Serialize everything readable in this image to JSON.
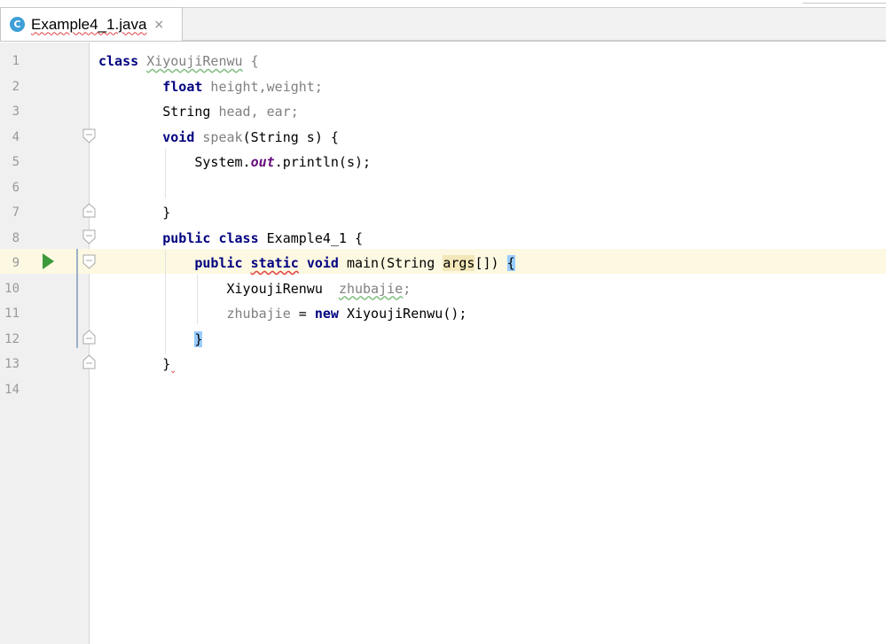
{
  "tab": {
    "icon_letter": "C",
    "title": "Example4_1.java",
    "close_glyph": "×"
  },
  "editor": {
    "current_line": 9,
    "line_numbers": [
      "1",
      "2",
      "3",
      "4",
      "5",
      "6",
      "7",
      "8",
      "9",
      "10",
      "11",
      "12",
      "13",
      "14"
    ],
    "lines": [
      [
        {
          "t": "class",
          "c": "kw"
        },
        {
          "t": " "
        },
        {
          "t": "XiyoujiRenwu",
          "c": "gray squiggle-green"
        },
        {
          "t": " {",
          "c": "gray"
        }
      ],
      [
        {
          "t": "        "
        },
        {
          "t": "float",
          "c": "kw"
        },
        {
          "t": " height,weight;",
          "c": "gray"
        }
      ],
      [
        {
          "t": "        String "
        },
        {
          "t": "head",
          "c": "gray"
        },
        {
          "t": ", ",
          "c": "gray"
        },
        {
          "t": "ear",
          "c": "gray"
        },
        {
          "t": ";",
          "c": "gray"
        }
      ],
      [
        {
          "t": "        "
        },
        {
          "t": "void",
          "c": "kw"
        },
        {
          "t": " "
        },
        {
          "t": "speak",
          "c": "gray"
        },
        {
          "t": "(String s) {"
        }
      ],
      [
        {
          "t": "            System."
        },
        {
          "t": "out",
          "c": "static-field"
        },
        {
          "t": ".println(s);"
        }
      ],
      [
        {
          "t": ""
        }
      ],
      [
        {
          "t": "        }"
        }
      ],
      [
        {
          "t": "        "
        },
        {
          "t": "public",
          "c": "kw"
        },
        {
          "t": " "
        },
        {
          "t": "class",
          "c": "kw"
        },
        {
          "t": " Example4_1 {"
        }
      ],
      [
        {
          "t": "            "
        },
        {
          "t": "public",
          "c": "kw"
        },
        {
          "t": " "
        },
        {
          "t": "static",
          "c": "kw squiggle-red"
        },
        {
          "t": " "
        },
        {
          "t": "void",
          "c": "kw"
        },
        {
          "t": " main(String "
        },
        {
          "t": "args",
          "c": "highlight-args"
        },
        {
          "t": "[]) "
        },
        {
          "t": "{",
          "c": "brace-match"
        }
      ],
      [
        {
          "t": "                XiyoujiRenwu  "
        },
        {
          "t": "zhubajie",
          "c": "gray squiggle-green"
        },
        {
          "t": ";",
          "c": "gray"
        }
      ],
      [
        {
          "t": "                "
        },
        {
          "t": "zhubajie",
          "c": "gray"
        },
        {
          "t": " = "
        },
        {
          "t": "new",
          "c": "kw"
        },
        {
          "t": " XiyoujiRenwu();"
        }
      ],
      [
        {
          "t": "            "
        },
        {
          "t": "}",
          "c": "brace-match"
        }
      ],
      [
        {
          "t": "        }"
        }
      ],
      [
        {
          "t": ""
        }
      ]
    ]
  }
}
